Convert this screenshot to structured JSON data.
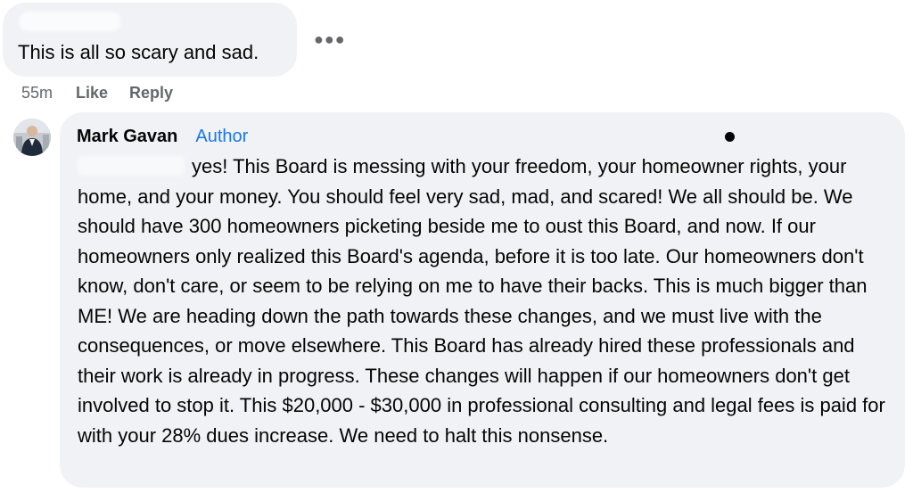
{
  "comment1": {
    "text": "This is all so scary and sad.",
    "more_icon": "more-horizontal-icon",
    "timestamp": "55m",
    "like_label": "Like",
    "reply_label": "Reply"
  },
  "reply": {
    "author": "Mark Gavan",
    "badge": "Author",
    "avatar_icon": "user-avatar",
    "text": "yes! This Board is messing with your freedom, your homeowner rights, your home, and your money. You should feel very sad, mad, and scared! We all should be. We should have 300 homeowners picketing beside me to oust this Board, and now. If our homeowners only realized this Board's agenda, before it is too late. Our homeowners don't know, don't care, or seem to be relying on me to have their backs. This is much bigger than ME! We are heading down the path towards these changes, and we must live with the consequences, or move elsewhere. This Board has already hired these professionals and their work is already in progress. These changes will happen if our homeowners don't get involved to stop it. This $20,000 - $30,000 in professional consulting and legal fees is paid for with your 28% dues increase. We need to halt this nonsense."
  },
  "colors": {
    "bubble": "#f0f2f5",
    "text": "#050505",
    "secondary": "#65676b",
    "accent": "#1877f2"
  }
}
